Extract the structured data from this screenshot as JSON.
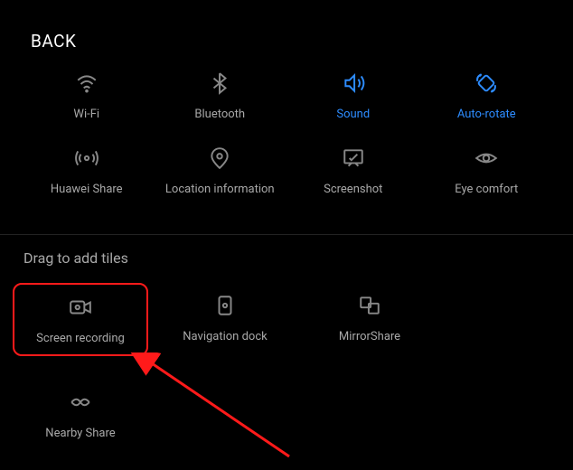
{
  "header": {
    "back": "BACK"
  },
  "activeTiles": {
    "row1": [
      {
        "id": "wifi",
        "label": "Wi-Fi",
        "active": false
      },
      {
        "id": "bluetooth",
        "label": "Bluetooth",
        "active": false
      },
      {
        "id": "sound",
        "label": "Sound",
        "active": true
      },
      {
        "id": "autorotate",
        "label": "Auto-rotate",
        "active": true
      }
    ],
    "row2": [
      {
        "id": "huaweishare",
        "label": "Huawei Share",
        "active": false
      },
      {
        "id": "location",
        "label": "Location information",
        "active": false
      },
      {
        "id": "screenshot",
        "label": "Screenshot",
        "active": false
      },
      {
        "id": "eyecomfort",
        "label": "Eye comfort",
        "active": false
      }
    ]
  },
  "hint": "Drag to add tiles",
  "inactiveTiles": {
    "row1": [
      {
        "id": "screenrecording",
        "label": "Screen recording",
        "highlighted": true
      },
      {
        "id": "navigationdock",
        "label": "Navigation dock",
        "highlighted": false
      },
      {
        "id": "mirrorshare",
        "label": "MirrorShare",
        "highlighted": false
      }
    ],
    "row2": [
      {
        "id": "nearbyshare",
        "label": "Nearby Share",
        "highlighted": false
      }
    ]
  },
  "colors": {
    "accent": "#2d8cff",
    "highlight": "#ff1a1a"
  }
}
